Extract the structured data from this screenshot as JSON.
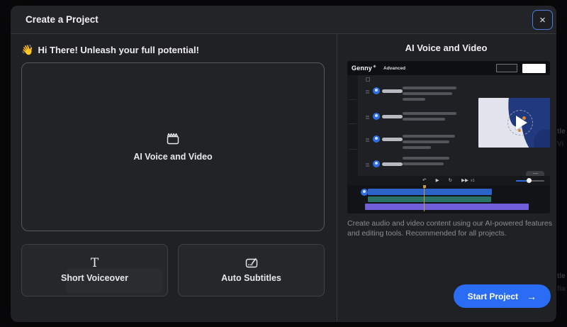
{
  "background": {
    "fragments": [
      {
        "text": "tle"
      },
      {
        "text": "Vi"
      },
      {
        "text": "tle"
      },
      {
        "text": "fia"
      }
    ]
  },
  "modal": {
    "title": "Create a Project",
    "close_icon": "×",
    "left": {
      "greeting_emoji": "👋",
      "greeting": "Hi There! Unleash your full potential!",
      "main_card": {
        "label": "AI Voice and Video"
      },
      "cards": [
        {
          "icon": "T",
          "label": "Short Voiceover"
        },
        {
          "label": "Auto Subtitles"
        }
      ]
    },
    "right": {
      "heading": "AI Voice and Video",
      "preview": {
        "logo": "Genny",
        "nav": "Advanced",
        "transport": {
          "rewind": "↶",
          "play": "▶",
          "loop": "↻",
          "ffwd": "▶▶",
          "speed": "x1"
        }
      },
      "description": "Create audio and video content using our AI-powered features and editing tools. Recommended for all projects.",
      "start_button": {
        "label": "Start Project",
        "arrow": "→"
      }
    }
  }
}
